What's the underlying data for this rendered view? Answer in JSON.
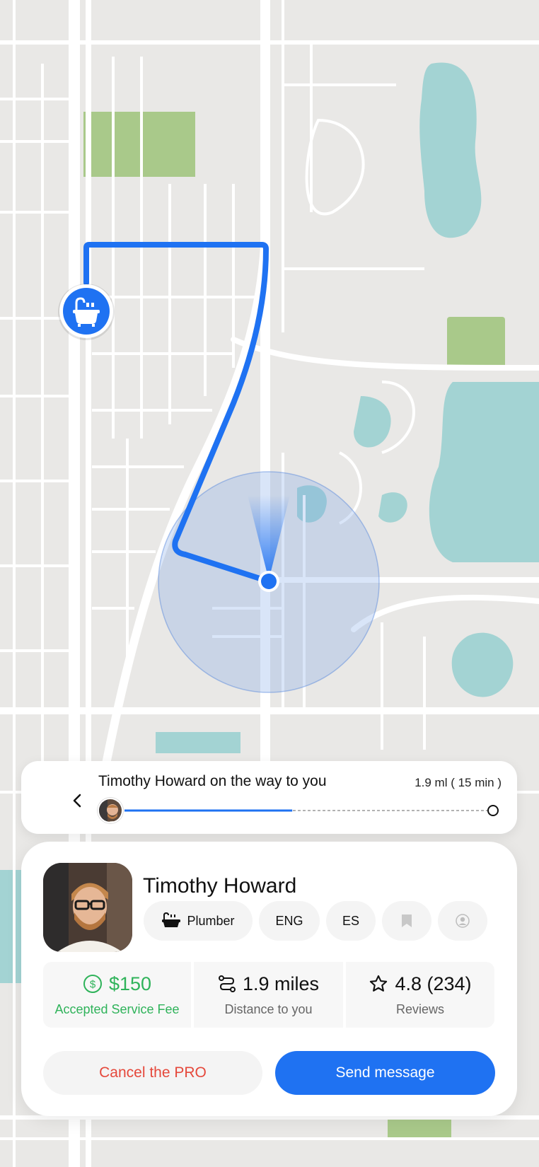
{
  "map": {
    "route_color": "#1f72f2",
    "destination_icon": "bathtub-icon",
    "current_location_icon": "location-dot-icon"
  },
  "tracker": {
    "title": "Timothy Howard on the way to you",
    "eta": "1.9 ml ( 15 min )",
    "progress": 0.45,
    "back_icon": "chevron-left-icon"
  },
  "pro": {
    "name": "Timothy Howard",
    "profession": "Plumber",
    "profession_icon": "bathtub-icon",
    "languages": [
      "ENG",
      "ES"
    ],
    "bookmark_icon": "bookmark-icon",
    "profile_icon": "user-circle-icon"
  },
  "stats": {
    "fee": {
      "value": "$150",
      "label": "Accepted Service Fee",
      "icon": "dollar-circle-icon",
      "color": "#2fb35a"
    },
    "distance": {
      "value": "1.9 miles",
      "label": "Distance to you",
      "icon": "route-icon"
    },
    "reviews": {
      "value": "4.8 (234)",
      "label": "Reviews",
      "icon": "star-icon"
    }
  },
  "actions": {
    "cancel_label": "Cancel the PRO",
    "send_label": "Send message"
  }
}
